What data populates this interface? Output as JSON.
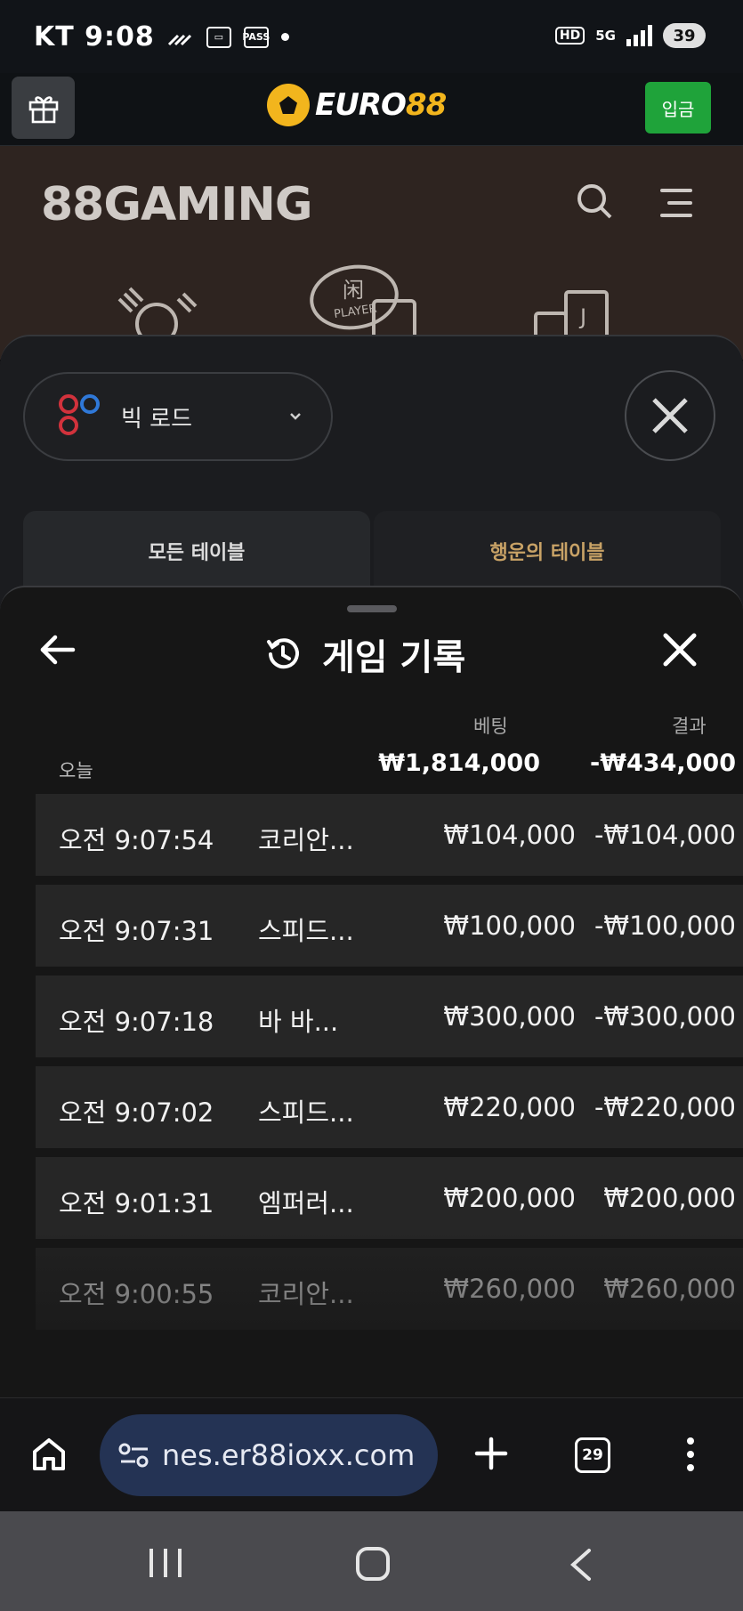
{
  "status_bar": {
    "carrier": "KT",
    "time": "9:08",
    "pass_label": "PASS",
    "hd_label": "HD",
    "network": "5G",
    "battery": "39"
  },
  "site_header": {
    "brand_prefix": "EURO",
    "brand_suffix": "88",
    "deposit_label": "입금",
    "brand_color": "#f2b51d",
    "deposit_color": "#1fa33a"
  },
  "gaming": {
    "logo_text": "88GAMING",
    "player_badge": "PLAYER"
  },
  "bigroad": {
    "selector_label": "빅 로드",
    "tabs": [
      {
        "label": "모든 테이블"
      },
      {
        "label": "행운의 테이블"
      }
    ]
  },
  "history": {
    "title": "게임 기록",
    "col_bet": "베팅",
    "col_result": "결과",
    "today_label": "오늘",
    "today_bet": "₩1,814,000",
    "today_result": "-₩434,000",
    "rows": [
      {
        "time": "오전 9:07:54",
        "game": "코리안...",
        "bet": "₩104,000",
        "result": "-₩104,000"
      },
      {
        "time": "오전 9:07:31",
        "game": "스피드...",
        "bet": "₩100,000",
        "result": "-₩100,000"
      },
      {
        "time": "오전 9:07:18",
        "game": "바 바...",
        "bet": "₩300,000",
        "result": "-₩300,000"
      },
      {
        "time": "오전 9:07:02",
        "game": "스피드...",
        "bet": "₩220,000",
        "result": "-₩220,000"
      },
      {
        "time": "오전 9:01:31",
        "game": "엠퍼러...",
        "bet": "₩200,000",
        "result": "₩200,000"
      },
      {
        "time": "오전 9:00:55",
        "game": "코리안...",
        "bet": "₩260,000",
        "result": "₩260,000"
      }
    ]
  },
  "browser": {
    "url": "nes.er88ioxx.com",
    "tab_count": "29"
  }
}
